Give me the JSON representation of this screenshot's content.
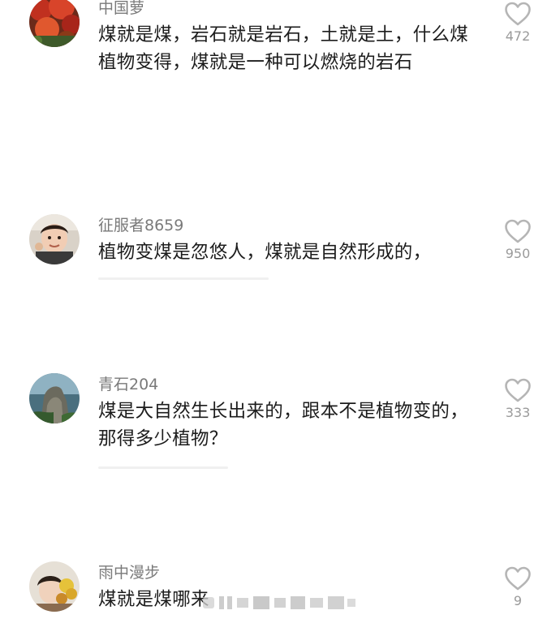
{
  "comments": [
    {
      "username": "中国萝",
      "text": "煤就是煤，岩石就是岩石，土就是土，什么煤植物变得，煤就是一种可以燃烧的岩石",
      "like_count": "472",
      "avatar_icon": "red-foliage-avatar"
    },
    {
      "username": "征服者8659",
      "text": "植物变煤是忽悠人，煤就是自然形成的，",
      "like_count": "950",
      "avatar_icon": "child-photo-avatar"
    },
    {
      "username": "青石204",
      "text": "煤是大自然生长出来的，跟本不是植物变的，那得多少植物？",
      "like_count": "333",
      "avatar_icon": "rock-sculpture-avatar"
    },
    {
      "username": "雨中漫步",
      "text": "煤就是煤哪来",
      "like_count": "9",
      "avatar_icon": "woman-flowers-avatar"
    }
  ],
  "like_icon": "heart-outline-icon",
  "colors": {
    "username": "#7a7a7a",
    "text": "#1c1c1c",
    "count": "#9a9a9a",
    "heart": "#b5b5b5"
  }
}
